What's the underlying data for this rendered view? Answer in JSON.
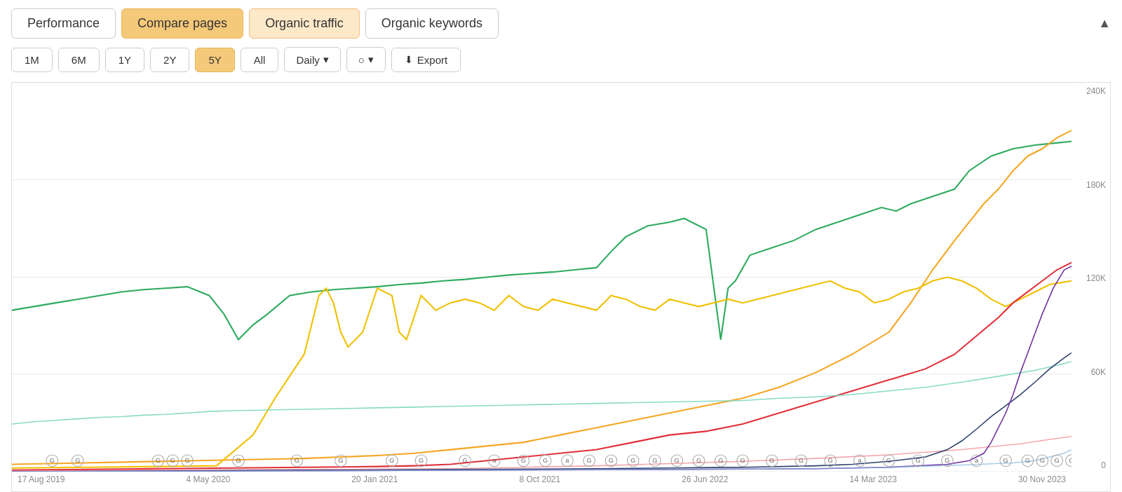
{
  "tabs": [
    {
      "label": "Performance",
      "state": "default",
      "id": "performance"
    },
    {
      "label": "Compare pages",
      "state": "active-orange",
      "id": "compare-pages"
    },
    {
      "label": "Organic traffic",
      "state": "active-light",
      "id": "organic-traffic"
    },
    {
      "label": "Organic keywords",
      "state": "default",
      "id": "organic-keywords"
    }
  ],
  "chevron": "▲",
  "period_buttons": [
    {
      "label": "1M",
      "active": false
    },
    {
      "label": "6M",
      "active": false
    },
    {
      "label": "1Y",
      "active": false
    },
    {
      "label": "2Y",
      "active": false
    },
    {
      "label": "5Y",
      "active": true
    },
    {
      "label": "All",
      "active": false
    }
  ],
  "daily_dropdown": "Daily",
  "annotation_dropdown": "○",
  "export_button": "Export",
  "y_axis_labels": [
    "240K",
    "180K",
    "120K",
    "60K",
    "0"
  ],
  "x_axis_labels": [
    "17 Aug 2019",
    "4 May 2020",
    "20 Jan 2021",
    "8 Oct 2021",
    "26 Jun 2022",
    "14 Mar 2023",
    "30 Nov 2023"
  ],
  "chart": {
    "colors": {
      "green": "#2eaa5e",
      "orange": "#f5a623",
      "yellow": "#f0c000",
      "red": "#e0303a",
      "light_teal": "#7dd6c0",
      "pink": "#f0a0a8",
      "dark_blue": "#2c3e6a",
      "purple": "#7030a0",
      "light_blue": "#a0c4e8"
    }
  }
}
